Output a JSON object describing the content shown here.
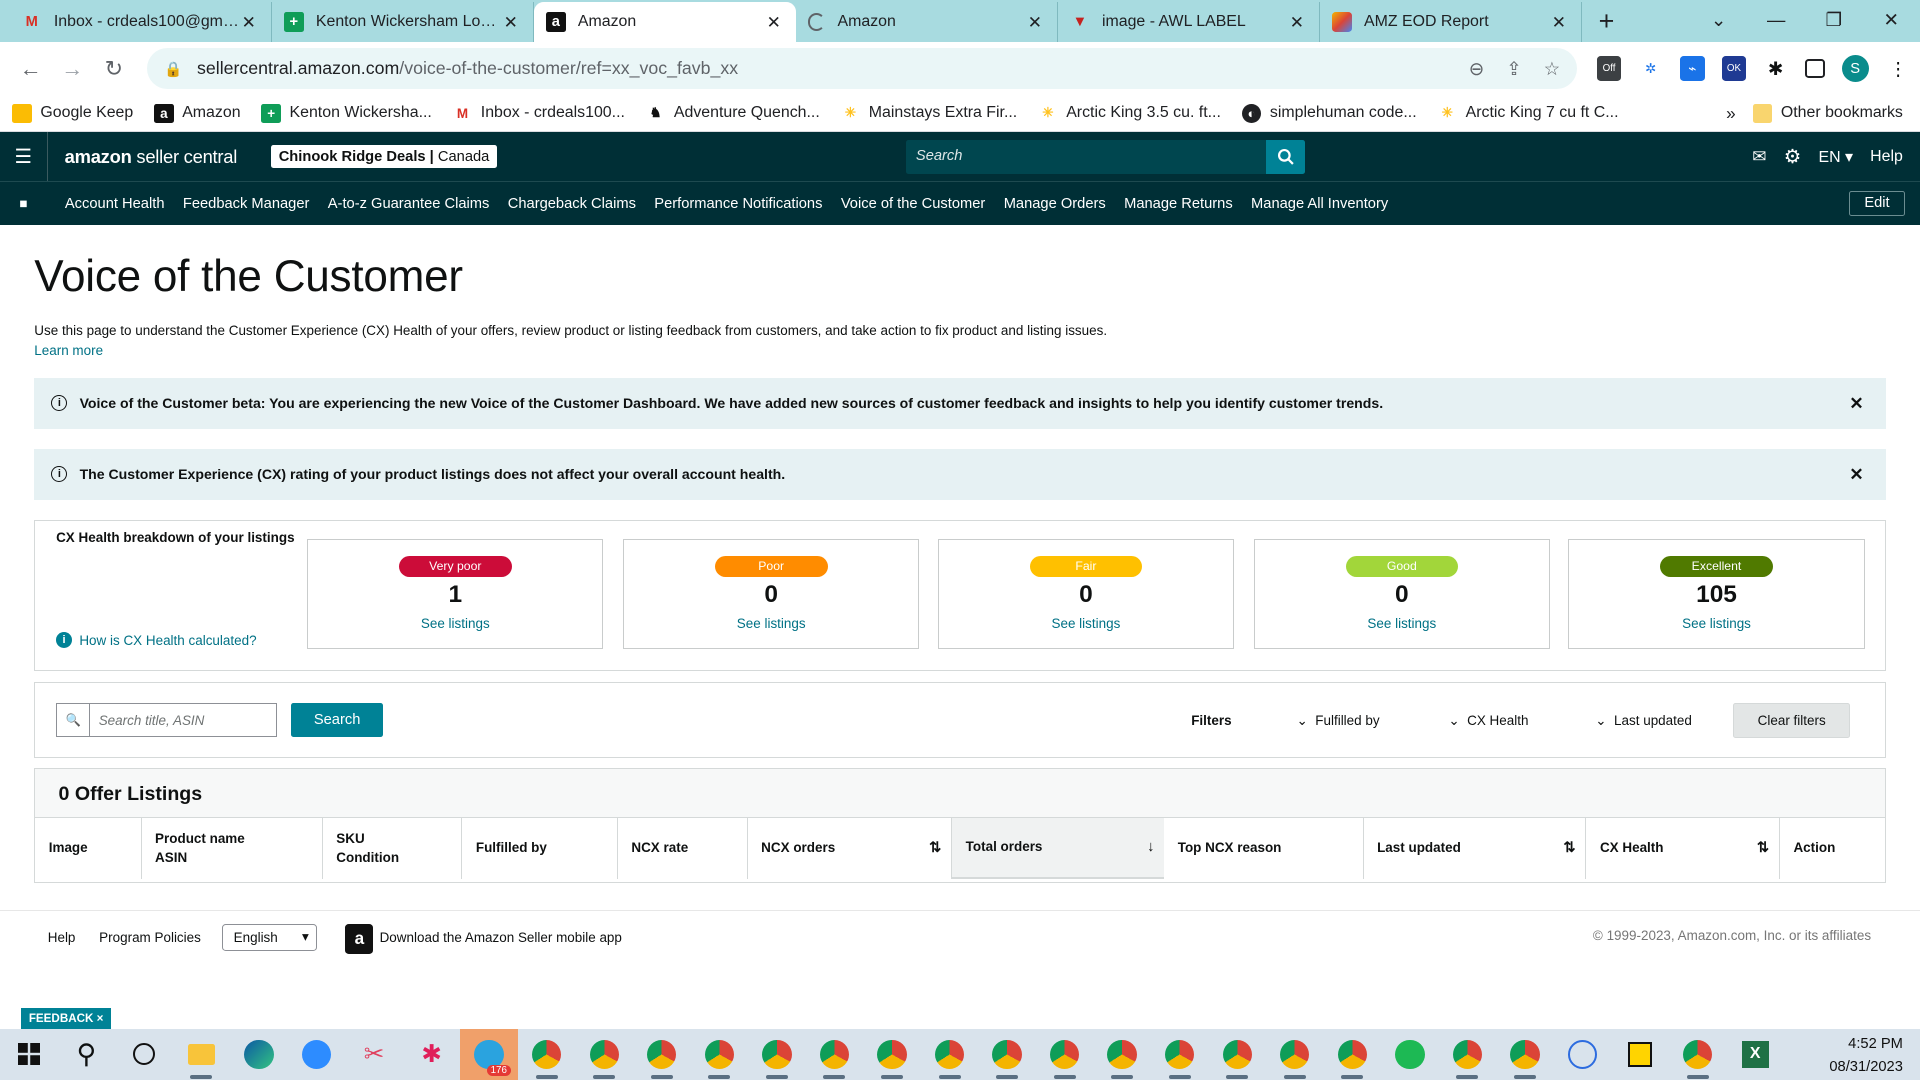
{
  "browser": {
    "tabs": [
      {
        "title": "Inbox - crdeals100@gmail.c",
        "icon": "gmail-icon",
        "active": false
      },
      {
        "title": "Kenton Wickersham Log in",
        "icon": "sheets-icon",
        "active": false
      },
      {
        "title": "Amazon",
        "icon": "amazon-icon",
        "active": true
      },
      {
        "title": "Amazon",
        "icon": "loading-icon",
        "active": false
      },
      {
        "title": "image - AWL LABEL",
        "icon": "awl-icon",
        "active": false
      },
      {
        "title": "AMZ EOD Report",
        "icon": "report-icon",
        "active": false
      }
    ],
    "url_domain": "sellercentral.amazon.com",
    "url_path": "/voice-of-the-customer/ref=xx_voc_favb_xx",
    "profile_initial": "S",
    "bookmarks": [
      {
        "label": "Google Keep",
        "icon": "keep-icon"
      },
      {
        "label": "Amazon",
        "icon": "amazon-icon"
      },
      {
        "label": "Kenton Wickersha...",
        "icon": "sheets-icon"
      },
      {
        "label": "Inbox - crdeals100...",
        "icon": "gmail-icon"
      },
      {
        "label": "Adventure Quench...",
        "icon": "bison-icon"
      },
      {
        "label": "Mainstays Extra Fir...",
        "icon": "walmart-icon"
      },
      {
        "label": "Arctic King 3.5 cu. ft...",
        "icon": "walmart-icon"
      },
      {
        "label": "simplehuman code...",
        "icon": "globe-icon"
      },
      {
        "label": "Arctic King 7 cu ft C...",
        "icon": "walmart-icon"
      }
    ],
    "more": "»",
    "other_bookmarks": "Other bookmarks"
  },
  "header": {
    "logo_main": "amazon",
    "logo_sub": "seller central",
    "store_name": "Chinook Ridge Deals",
    "store_region": "Canada",
    "search_placeholder": "Search",
    "lang": "EN",
    "help": "Help"
  },
  "nav": {
    "items": [
      "Account Health",
      "Feedback Manager",
      "A-to-z Guarantee Claims",
      "Chargeback Claims",
      "Performance Notifications",
      "Voice of the Customer",
      "Manage Orders",
      "Manage Returns",
      "Manage All Inventory"
    ],
    "edit": "Edit"
  },
  "page": {
    "title": "Voice of the Customer",
    "description": "Use this page to understand the Customer Experience (CX) Health of your offers, review product or listing feedback from customers, and take action to fix product and listing issues.",
    "learn_more": "Learn more",
    "alerts": [
      "Voice of the Customer beta: You are experiencing the new Voice of the Customer Dashboard. We have added new sources of customer feedback and insights to help you identify customer trends.",
      "The Customer Experience (CX) rating of your product listings does not affect your overall account health."
    ]
  },
  "cx": {
    "title": "CX Health breakdown of your listings",
    "how_link": "How is CX Health calculated?",
    "cards": [
      {
        "label": "Very poor",
        "count": "1",
        "link": "See listings",
        "color": "#cc0c39"
      },
      {
        "label": "Poor",
        "count": "0",
        "link": "See listings",
        "color": "#ff8c00"
      },
      {
        "label": "Fair",
        "count": "0",
        "link": "See listings",
        "color": "#ffc000"
      },
      {
        "label": "Good",
        "count": "0",
        "link": "See listings",
        "color": "#a2d63a"
      },
      {
        "label": "Excellent",
        "count": "105",
        "link": "See listings",
        "color": "#507a00"
      }
    ]
  },
  "filters": {
    "search_placeholder": "Search title, ASIN",
    "search_button": "Search",
    "filters_label": "Filters",
    "fulfilled_by": "Fulfilled by",
    "cx_health": "CX Health",
    "last_updated": "Last updated",
    "clear": "Clear filters"
  },
  "table": {
    "heading": "0 Offer Listings",
    "columns": [
      {
        "l1": "Image",
        "l2": ""
      },
      {
        "l1": "Product name",
        "l2": "ASIN"
      },
      {
        "l1": "SKU",
        "l2": "Condition"
      },
      {
        "l1": "Fulfilled by",
        "l2": ""
      },
      {
        "l1": "NCX rate",
        "l2": ""
      },
      {
        "l1": "NCX orders",
        "l2": ""
      },
      {
        "l1": "Total orders",
        "l2": ""
      },
      {
        "l1": "Top NCX reason",
        "l2": ""
      },
      {
        "l1": "Last updated",
        "l2": ""
      },
      {
        "l1": "CX Health",
        "l2": ""
      },
      {
        "l1": "Action",
        "l2": ""
      }
    ]
  },
  "footer": {
    "help": "Help",
    "policies": "Program Policies",
    "language": "English",
    "app": "Download the Amazon Seller mobile app",
    "copyright": "© 1999-2023, Amazon.com, Inc. or its affiliates",
    "feedback": "FEEDBACK ×"
  },
  "taskbar": {
    "time": "4:52 PM",
    "date": "08/31/2023",
    "telegram_badge": "176"
  }
}
